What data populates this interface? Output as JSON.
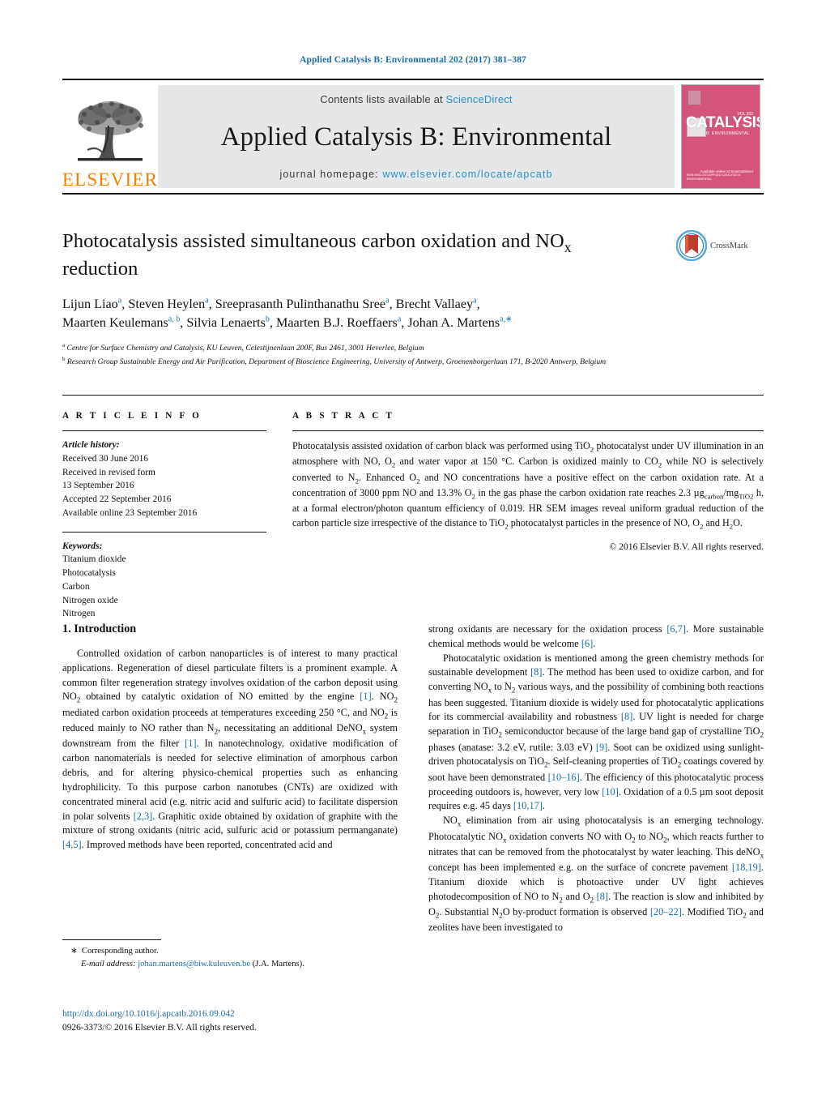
{
  "running_head": "Applied Catalysis B: Environmental 202 (2017) 381–387",
  "masthead": {
    "contents_prefix": "Contents lists available at ",
    "sciencedirect": "ScienceDirect",
    "journal_title": "Applied Catalysis B: Environmental",
    "homepage_prefix": "journal homepage: ",
    "homepage_url": "www.elsevier.com/locate/apcatb",
    "publisher": "ELSEVIER",
    "cover": {
      "big_text": "CATALYSIS",
      "sub_text": "B: ENVIRONMENTAL",
      "top_right": "VOL 202",
      "sciencedirect": "Available online at\nScienceDirect",
      "bottom_left": "ISSN 0926-3373\nAPPLIED CATALYSIS B:\nENVIRONMENTAL"
    }
  },
  "crossmark": {
    "label": "CrossMark"
  },
  "article": {
    "title_line1": "Photocatalysis assisted simultaneous carbon oxidation and NO",
    "title_sub": "x",
    "title_line2": "reduction",
    "authors_line1": "Lijun Liao|a|, Steven Heylen|a|, Sreeprasanth Pulinthanathu Sree|a|, Brecht Vallaey|a|,",
    "authors_line2": "Maarten Keulemans|a, b|, Silvia Lenaerts|b|, Maarten B.J. Roeffaers|a|, Johan A. Martens|a, *|",
    "affiliation_a": "Centre for Surface Chemistry and Catalysis, KU Leuven, Celestijnenlaan 200F, Bus 2461, 3001 Heverlee, Belgium",
    "affiliation_b": "Research Group Sustainable Energy and Air Purification, Department of Bioscience Engineering, University of Antwerp, Groenenborgerlaan 171, B-2020 Antwerp, Belgium"
  },
  "article_info": {
    "heading": "A R T I C L E   I N F O",
    "history_label": "Article history:",
    "history": [
      "Received 30 June 2016",
      "Received in revised form",
      "13 September 2016",
      "Accepted 22 September 2016",
      "Available online 23 September 2016"
    ],
    "keywords_label": "Keywords:",
    "keywords": [
      "Titanium dioxide",
      "Photocatalysis",
      "Carbon",
      "Nitrogen oxide",
      "Nitrogen"
    ]
  },
  "abstract": {
    "heading": "A B S T R A C T",
    "copyright": "© 2016 Elsevier B.V. All rights reserved."
  },
  "introduction": {
    "heading": "1.  Introduction"
  },
  "footnote": {
    "corresponding": "Corresponding author.",
    "email_label": "E-mail address:",
    "email": "johan.martens@biw.kuleuven.be",
    "email_suffix": "(J.A. Martens)."
  },
  "footer": {
    "doi": "http://dx.doi.org/10.1016/j.apcatb.2016.09.042",
    "issn_copyright": "0926-3373/© 2016 Elsevier B.V. All rights reserved."
  },
  "colors": {
    "link": "#1a6ea8",
    "sciencedirect": "#2d8fc4",
    "elsevier_orange": "#f08000",
    "band_gray": "#e6e7e8",
    "cover_pink": "#d4557b"
  }
}
